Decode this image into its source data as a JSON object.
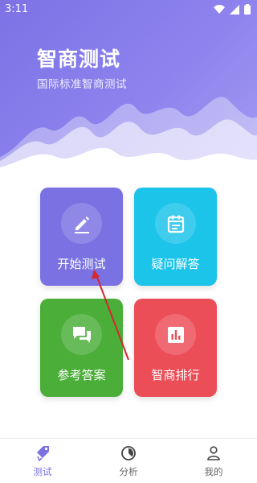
{
  "status_bar": {
    "time": "3:11"
  },
  "hero": {
    "title": "智商测试",
    "subtitle": "国际标准智商测试"
  },
  "tiles": [
    {
      "label": "开始测试",
      "icon": "pencil-icon",
      "color": "#7a72e2"
    },
    {
      "label": "疑问解答",
      "icon": "calendar-note-icon",
      "color": "#1cc4ea"
    },
    {
      "label": "参考答案",
      "icon": "chat-bubbles-icon",
      "color": "#4aae39"
    },
    {
      "label": "智商排行",
      "icon": "bar-chart-icon",
      "color": "#ec4e58"
    }
  ],
  "bottom_nav": {
    "items": [
      {
        "label": "测试",
        "icon": "test-tag-icon",
        "active": true
      },
      {
        "label": "分析",
        "icon": "analysis-dial-icon",
        "active": false
      },
      {
        "label": "我的",
        "icon": "person-icon",
        "active": false
      }
    ]
  },
  "colors": {
    "accent": "#7a72e2",
    "annotation_arrow": "#d8262b"
  }
}
